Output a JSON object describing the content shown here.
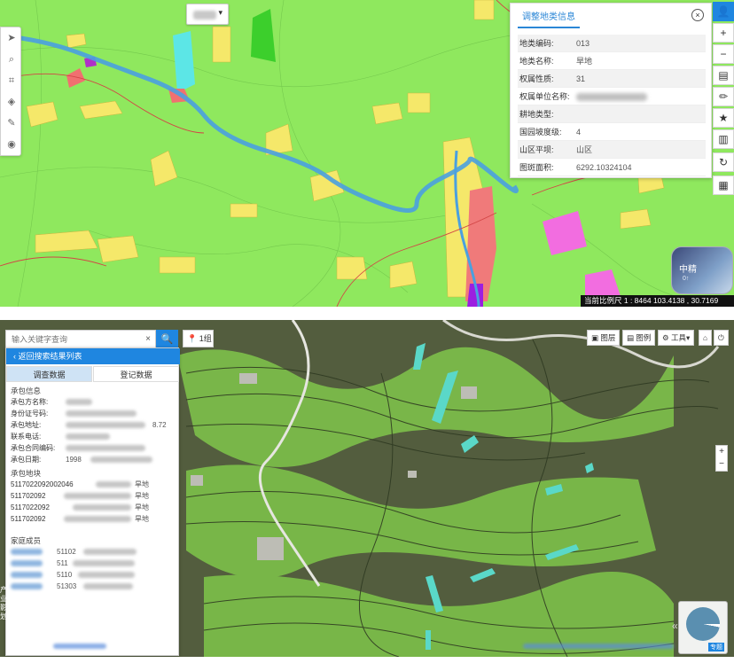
{
  "top_map": {
    "district_select": {
      "caret": "▾"
    },
    "left_tools": [
      {
        "name": "locate-icon",
        "glyph": "➤"
      },
      {
        "name": "search-icon",
        "glyph": "⌕"
      },
      {
        "name": "measure-icon",
        "glyph": "⌗"
      },
      {
        "name": "layers-icon",
        "glyph": "◈"
      },
      {
        "name": "draw-icon",
        "glyph": "✎"
      },
      {
        "name": "eye-icon",
        "glyph": "◉"
      }
    ],
    "info_panel": {
      "title": "调整地类信息",
      "close": "×",
      "rows": [
        {
          "key": "地类编码:",
          "value": "013"
        },
        {
          "key": "地类名称:",
          "value": "旱地"
        },
        {
          "key": "权属性质:",
          "value": "31"
        },
        {
          "key": "权属单位名称:",
          "value": ""
        },
        {
          "key": "耕地类型:",
          "value": ""
        },
        {
          "key": "国园坡度级:",
          "value": "4"
        },
        {
          "key": "山区平坝:",
          "value": "山区"
        },
        {
          "key": "图斑面积:",
          "value": "6292.10324104"
        }
      ]
    },
    "right_tools": [
      {
        "name": "user-icon",
        "glyph": "👤"
      },
      {
        "name": "zoom-in-icon",
        "glyph": "+"
      },
      {
        "name": "zoom-out-icon",
        "glyph": "−"
      },
      {
        "name": "toolbox-icon",
        "glyph": "▤"
      },
      {
        "name": "pen-icon",
        "glyph": "✏"
      },
      {
        "name": "star-icon",
        "glyph": "★"
      },
      {
        "name": "chart-icon",
        "glyph": "▥"
      },
      {
        "name": "refresh-icon",
        "glyph": "↻"
      },
      {
        "name": "grid-icon",
        "glyph": "▦"
      }
    ],
    "scale_text": "当前比例尺 1 : 8464   103.4138 , 30.7169",
    "avatar_widget": {
      "text": "中精",
      "sub": "0↑"
    }
  },
  "bottom_map": {
    "search": {
      "placeholder": "输入关键字查询",
      "clear": "×",
      "button": "🔍"
    },
    "location_select": "1组",
    "location_icon": "📍",
    "result_panel": {
      "back_label": "返回搜索结果列表",
      "tabs": [
        "调查数据",
        "登记数据"
      ],
      "section_contract": "承包信息",
      "fields": [
        {
          "key": "承包方名称:",
          "value": ""
        },
        {
          "key": "身份证号码:",
          "value": ""
        },
        {
          "key": "承包地址:",
          "value": "8.72"
        },
        {
          "key": "联系电话:",
          "value": ""
        },
        {
          "key": "承包合同编码:",
          "value": ""
        },
        {
          "key": "承包日期:",
          "value": "1998"
        }
      ],
      "section_land": "承包地块",
      "parcels": [
        {
          "code": "5117022092002046",
          "suffix": "旱地"
        },
        {
          "code": "511702092",
          "suffix": "旱地"
        },
        {
          "code": "5117022092",
          "suffix": "旱地"
        },
        {
          "code": "511702092",
          "suffix": "旱地"
        }
      ],
      "section_family": "家庭成员",
      "members": [
        {
          "code": "51102"
        },
        {
          "code": "511"
        },
        {
          "code": "5110"
        },
        {
          "code": "51303"
        }
      ]
    },
    "toolbar": [
      {
        "name": "layer-button",
        "label": "▣ 图层"
      },
      {
        "name": "legend-button",
        "label": "▤ 图例"
      },
      {
        "name": "tools-button",
        "label": "⚙ 工具▾"
      },
      {
        "name": "home-button",
        "label": "⌂"
      },
      {
        "name": "power-button",
        "label": "⏻"
      }
    ],
    "zoom": {
      "in": "+",
      "out": "−"
    },
    "legend_widget": {
      "label": "专题"
    },
    "collapse_arrow": "«",
    "side_labels": [
      "产",
      "业",
      "影",
      "划"
    ]
  }
}
